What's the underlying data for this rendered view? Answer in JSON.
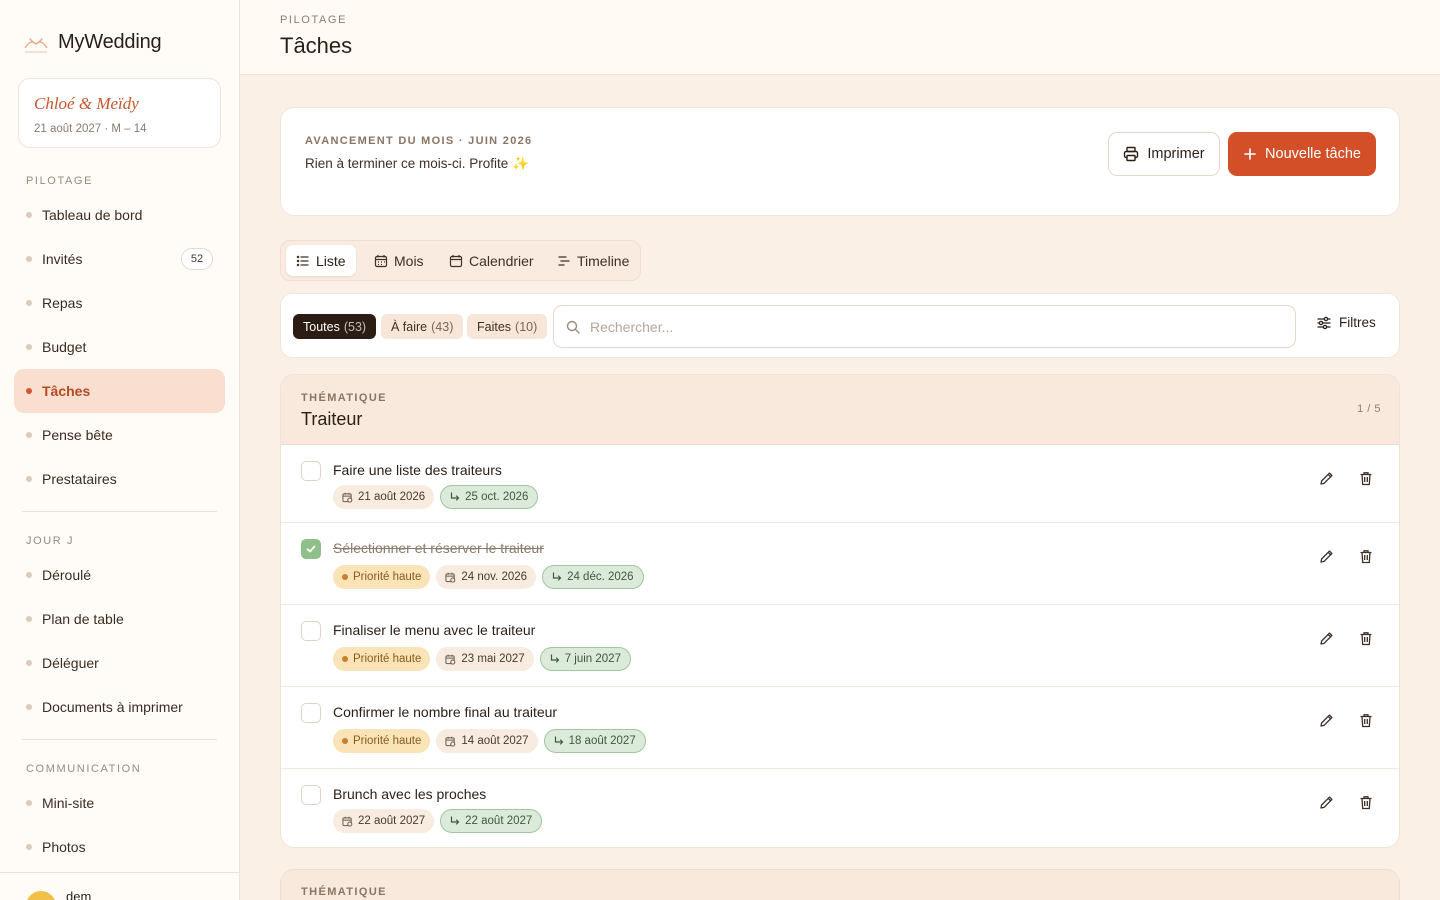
{
  "app": {
    "name": "MyWedding"
  },
  "couple": {
    "names": "Chloé & Meïdy",
    "date_line": "21 août 2027 · M – 14"
  },
  "sidebar": {
    "sections": [
      {
        "label": "PILOTAGE"
      },
      {
        "label": "JOUR J"
      },
      {
        "label": "COMMUNICATION"
      }
    ],
    "items": [
      {
        "label": "Tableau de bord"
      },
      {
        "label": "Invités",
        "badge": "52"
      },
      {
        "label": "Repas"
      },
      {
        "label": "Budget"
      },
      {
        "label": "Tâches",
        "active": true
      },
      {
        "label": "Pense bête"
      },
      {
        "label": "Prestataires"
      },
      {
        "label": "Déroulé"
      },
      {
        "label": "Plan de table"
      },
      {
        "label": "Déléguer"
      },
      {
        "label": "Documents à imprimer"
      },
      {
        "label": "Mini-site"
      },
      {
        "label": "Photos"
      }
    ],
    "user": {
      "name": "dem"
    }
  },
  "header": {
    "crumb": "PILOTAGE",
    "title": "Tâches"
  },
  "progress": {
    "label": "AVANCEMENT DU MOIS · JUIN 2026",
    "text": "Rien à terminer ce mois-ci. Profite ✨",
    "print_label": "Imprimer",
    "new_label": "Nouvelle tâche"
  },
  "view_tabs": [
    {
      "label": "Liste",
      "active": true
    },
    {
      "label": "Mois"
    },
    {
      "label": "Calendrier"
    },
    {
      "label": "Timeline"
    }
  ],
  "filters": {
    "chips": [
      {
        "label": "Toutes",
        "count": "(53)",
        "active": true
      },
      {
        "label": "À faire",
        "count": "(43)"
      },
      {
        "label": "Faites",
        "count": "(10)"
      }
    ],
    "search_placeholder": "Rechercher...",
    "filters_label": "Filtres"
  },
  "groups": [
    {
      "label": "THÉMATIQUE",
      "title": "Traiteur",
      "count": "1 / 5",
      "tasks": [
        {
          "title": "Faire une liste des traiteurs",
          "done": false,
          "priority": "",
          "date": "21 août 2026",
          "due": "25 oct. 2026"
        },
        {
          "title": "Sélectionner et réserver le traiteur",
          "done": true,
          "priority": "Priorité haute",
          "date": "24 nov. 2026",
          "due": "24 déc. 2026"
        },
        {
          "title": "Finaliser le menu avec le traiteur",
          "done": false,
          "priority": "Priorité haute",
          "date": "23 mai 2027",
          "due": "7 juin 2027"
        },
        {
          "title": "Confirmer le nombre final au traiteur",
          "done": false,
          "priority": "Priorité haute",
          "date": "14 août 2027",
          "due": "18 août 2027"
        },
        {
          "title": "Brunch avec les proches",
          "done": false,
          "priority": "",
          "date": "22 août 2027",
          "due": "22 août 2027"
        }
      ]
    },
    {
      "label": "THÉMATIQUE"
    }
  ],
  "colors": {
    "accent": "#d24f28",
    "active_bg": "#fadfd0",
    "done_green": "#8fbf8a",
    "priority_bg": "#fbe3b8"
  }
}
